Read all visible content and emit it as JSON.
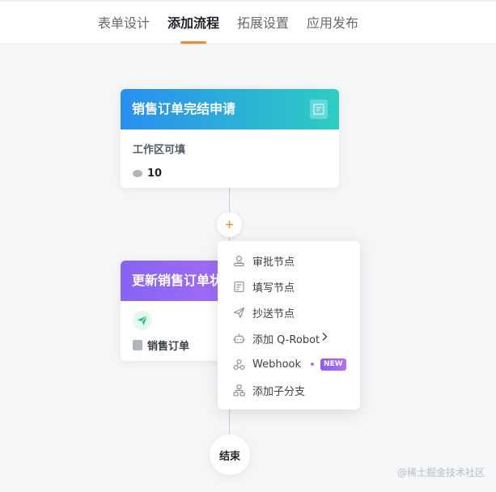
{
  "tabs": [
    {
      "label": "表单设计",
      "active": false
    },
    {
      "label": "添加流程",
      "active": true
    },
    {
      "label": "拓展设置",
      "active": false
    },
    {
      "label": "应用发布",
      "active": false
    }
  ],
  "accent_color": "#f08c2e",
  "node1": {
    "title": "销售订单完结申请",
    "subtitle": "工作区可填",
    "count": "10",
    "gradient": [
      "#2a8ff0",
      "#2ccdc2"
    ],
    "icon": "form-edit-icon"
  },
  "node2": {
    "title": "更新销售订单状态",
    "form_name": "销售订单",
    "gradient": [
      "#8663f5",
      "#a56ef7"
    ],
    "icon": "send-icon"
  },
  "add_button": {
    "icon": "plus-icon"
  },
  "menu": {
    "items": [
      {
        "label": "审批节点",
        "icon": "approver-icon"
      },
      {
        "label": "填写节点",
        "icon": "fill-form-icon"
      },
      {
        "label": "抄送节点",
        "icon": "cc-send-icon"
      },
      {
        "label": "添加 Q-Robot",
        "icon": "robot-icon",
        "has_submenu": true
      },
      {
        "label": "Webhook",
        "icon": "webhook-icon",
        "badge": "NEW"
      },
      {
        "label": "添加子分支",
        "icon": "branch-icon"
      }
    ]
  },
  "end_node": {
    "label": "结束"
  },
  "watermark": "@稀土掘金技术社区"
}
